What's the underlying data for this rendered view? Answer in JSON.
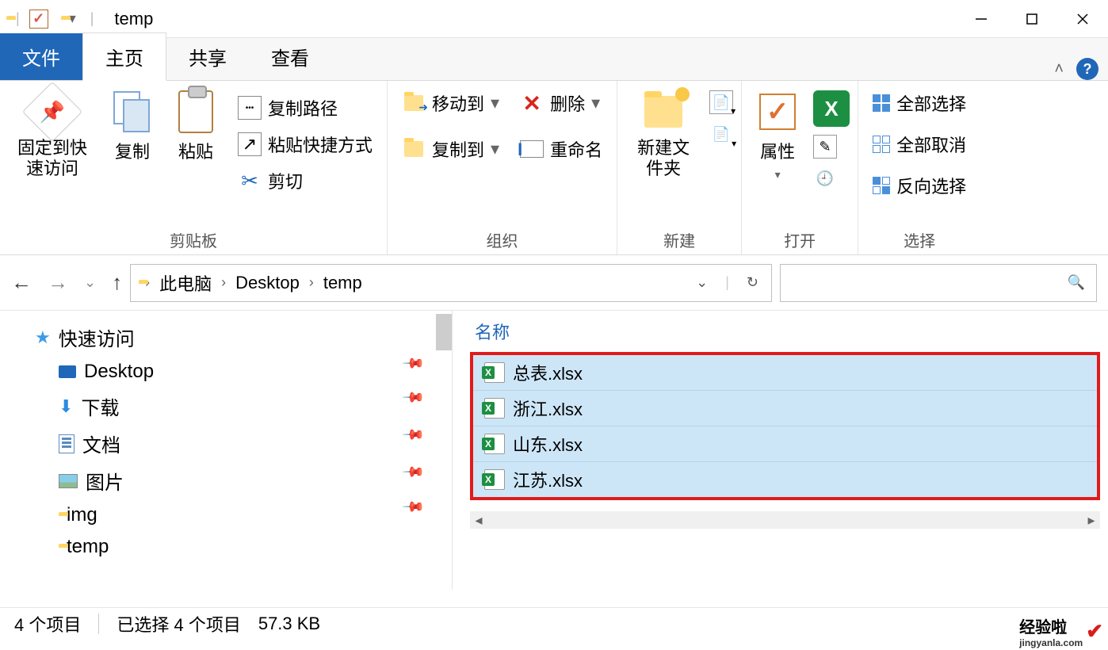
{
  "titlebar": {
    "title": "temp"
  },
  "tabs": {
    "file": "文件",
    "home": "主页",
    "share": "共享",
    "view": "查看"
  },
  "ribbon": {
    "clipboard": {
      "label": "剪贴板",
      "pin": "固定到快速访问",
      "copy": "复制",
      "paste": "粘贴",
      "copyPath": "复制路径",
      "pasteShortcut": "粘贴快捷方式",
      "cut": "剪切"
    },
    "organize": {
      "label": "组织",
      "moveTo": "移动到",
      "copyTo": "复制到",
      "delete": "删除",
      "rename": "重命名"
    },
    "new": {
      "label": "新建",
      "newFolder": "新建文件夹"
    },
    "open": {
      "label": "打开",
      "properties": "属性"
    },
    "select": {
      "label": "选择",
      "selectAll": "全部选择",
      "selectNone": "全部取消",
      "invert": "反向选择"
    }
  },
  "breadcrumb": {
    "thisPC": "此电脑",
    "desktop": "Desktop",
    "temp": "temp"
  },
  "sidebar": {
    "quickAccess": "快速访问",
    "desktop": "Desktop",
    "downloads": "下载",
    "documents": "文档",
    "pictures": "图片",
    "img": "img",
    "temp": "temp"
  },
  "content": {
    "nameHeader": "名称",
    "files": [
      "总表.xlsx",
      "浙江.xlsx",
      "山东.xlsx",
      "江苏.xlsx"
    ]
  },
  "statusbar": {
    "items": "4 个项目",
    "selected": "已选择 4 个项目",
    "size": "57.3 KB"
  },
  "watermark": {
    "brand": "经验啦",
    "site": "jingyanla.com"
  }
}
